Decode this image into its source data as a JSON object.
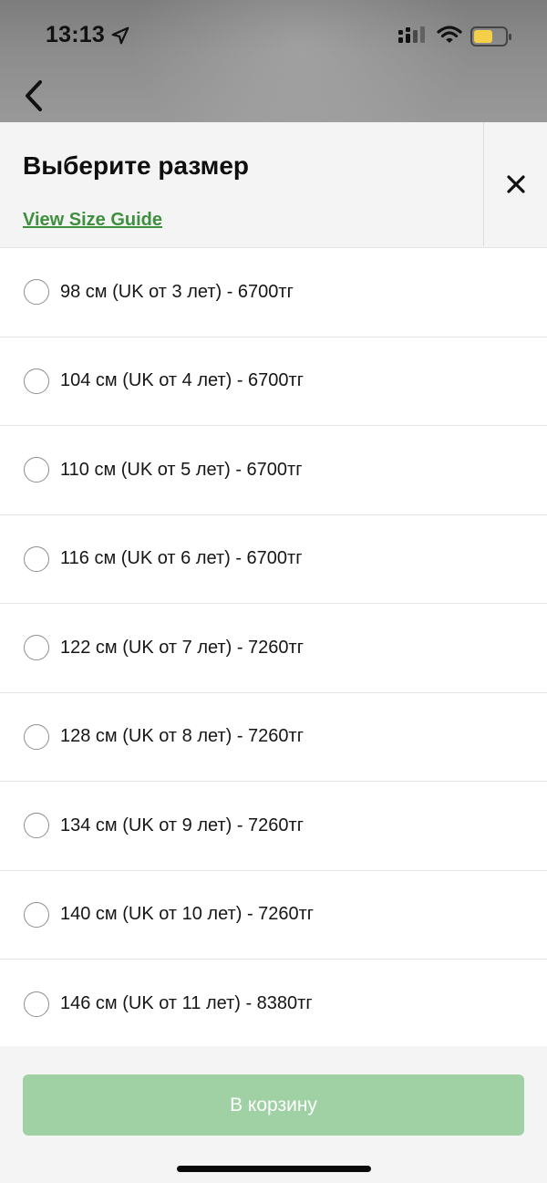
{
  "status_bar": {
    "time": "13:13",
    "icons": [
      "location-arrow-icon",
      "signal-icon",
      "wifi-icon",
      "battery-icon"
    ],
    "battery_color": "#f3cf4a"
  },
  "navigation": {
    "back_icon": "chevron-left-icon"
  },
  "sheet": {
    "title": "Выберите размер",
    "size_guide_link": "View Size Guide",
    "close_icon": "close-icon"
  },
  "sizes": [
    {
      "label": "98 см (UK от 3 лет) - 6700тг"
    },
    {
      "label": "104 см (UK от 4 лет) - 6700тг"
    },
    {
      "label": "110 см (UK от 5 лет) - 6700тг"
    },
    {
      "label": "116 см (UK от 6 лет) - 6700тг"
    },
    {
      "label": "122 см (UK от 7 лет) - 7260тг"
    },
    {
      "label": "128 см (UK от 8 лет) - 7260тг"
    },
    {
      "label": "134 см (UK от 9 лет) - 7260тг"
    },
    {
      "label": "140 см (UK от 10 лет) - 7260тг"
    },
    {
      "label": "146 см (UK от 11 лет) - 8380тг"
    }
  ],
  "footer": {
    "add_to_cart_label": "В корзину"
  },
  "colors": {
    "accent_link": "#3e8f3e",
    "button_disabled": "#9fd1a4"
  }
}
